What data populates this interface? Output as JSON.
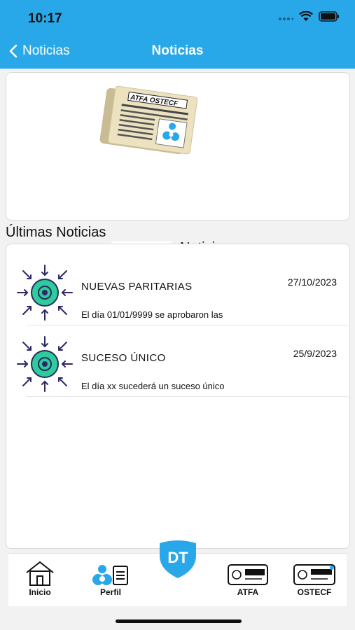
{
  "status_bar": {
    "time": "10:17"
  },
  "nav": {
    "back_label": "Noticias",
    "title": "Noticias"
  },
  "header": {
    "brand": "ATFA",
    "subtitle": "Noticias",
    "paper_logo": "ATFA OSTECF"
  },
  "section": {
    "title": "Últimas Noticias"
  },
  "news": [
    {
      "title": "NUEVAS PARITARIAS",
      "date": "27/10/2023",
      "summary": "El día 01/01/9999 se aprobaron las"
    },
    {
      "title": "SUCESO ÚNICO",
      "date": "25/9/2023",
      "summary": "El día xx sucederá un suceso único"
    }
  ],
  "tabs": [
    {
      "label": "Inicio",
      "icon": "home-icon"
    },
    {
      "label": "Perfil",
      "icon": "profile-icon"
    },
    {
      "label": "ATFA",
      "icon": "atfa-card-icon"
    },
    {
      "label": "OSTECF",
      "icon": "ostecf-card-icon"
    }
  ],
  "center_badge": {
    "label": "DT"
  },
  "colors": {
    "accent": "#29a8e9",
    "news_icon": "#2ecc9a",
    "arrow": "#2b2a66"
  }
}
